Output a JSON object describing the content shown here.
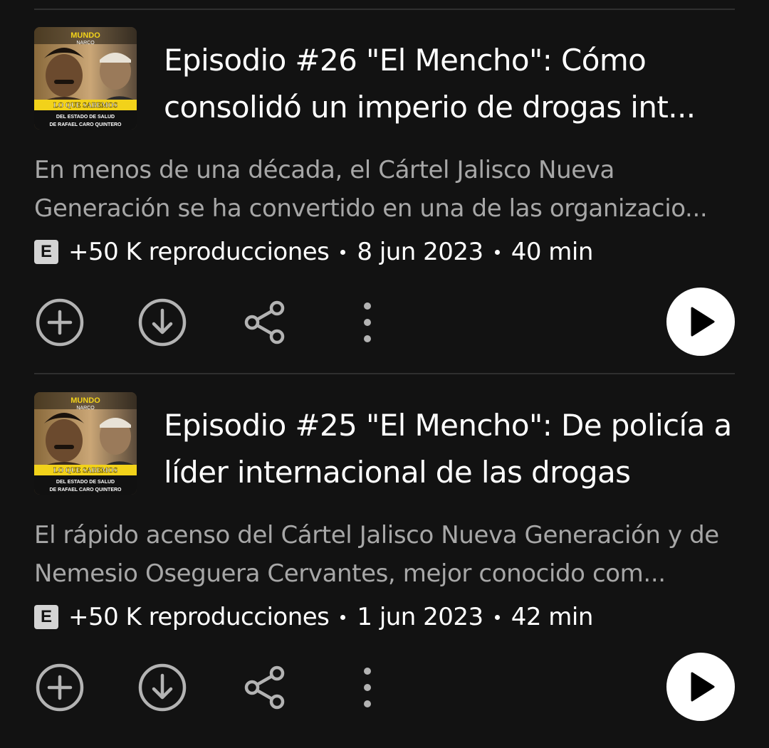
{
  "episodes": [
    {
      "title": "Episodio #26 \"El Mencho\": Cómo consolidó un imperio de drogas int...",
      "description": "En menos de una década, el Cártel Jalisco Nueva Generación se ha convertido en una de las organizacio...",
      "explicit_badge": "E",
      "plays": "+50 K reproducciones",
      "date": "8 jun 2023",
      "duration": "40 min",
      "thumbnail": {
        "brand_top": "MUNDO",
        "brand_bottom": "NARCO",
        "banner": "LO QUE SABEMOS",
        "caption_line1": "DEL ESTADO DE SALUD",
        "caption_line2": "DE RAFAEL CARO QUINTERO"
      },
      "icons": {
        "add": "add-circle-icon",
        "download": "download-circle-icon",
        "share": "share-icon",
        "more": "more-vertical-icon",
        "play": "play-icon"
      }
    },
    {
      "title": "Episodio #25 \"El Mencho\": De policía a líder internacional de las drogas",
      "description": "El rápido acenso del Cártel Jalisco Nueva Generación y de Nemesio Oseguera Cervantes, mejor conocido com...",
      "explicit_badge": "E",
      "plays": "+50 K reproducciones",
      "date": "1 jun 2023",
      "duration": "42 min",
      "thumbnail": {
        "brand_top": "MUNDO",
        "brand_bottom": "NARCO",
        "banner": "LO QUE SABEMOS",
        "caption_line1": "DEL ESTADO DE SALUD",
        "caption_line2": "DE RAFAEL CARO QUINTERO"
      },
      "icons": {
        "add": "add-circle-icon",
        "download": "download-circle-icon",
        "share": "share-icon",
        "more": "more-vertical-icon",
        "play": "play-icon"
      }
    }
  ],
  "colors": {
    "background": "#121212",
    "title_text": "#ffffff",
    "secondary_text": "#a7a7a7",
    "icon": "#b3b3b3",
    "divider": "#2f2f2f",
    "banner_yellow": "#f2d21a"
  }
}
